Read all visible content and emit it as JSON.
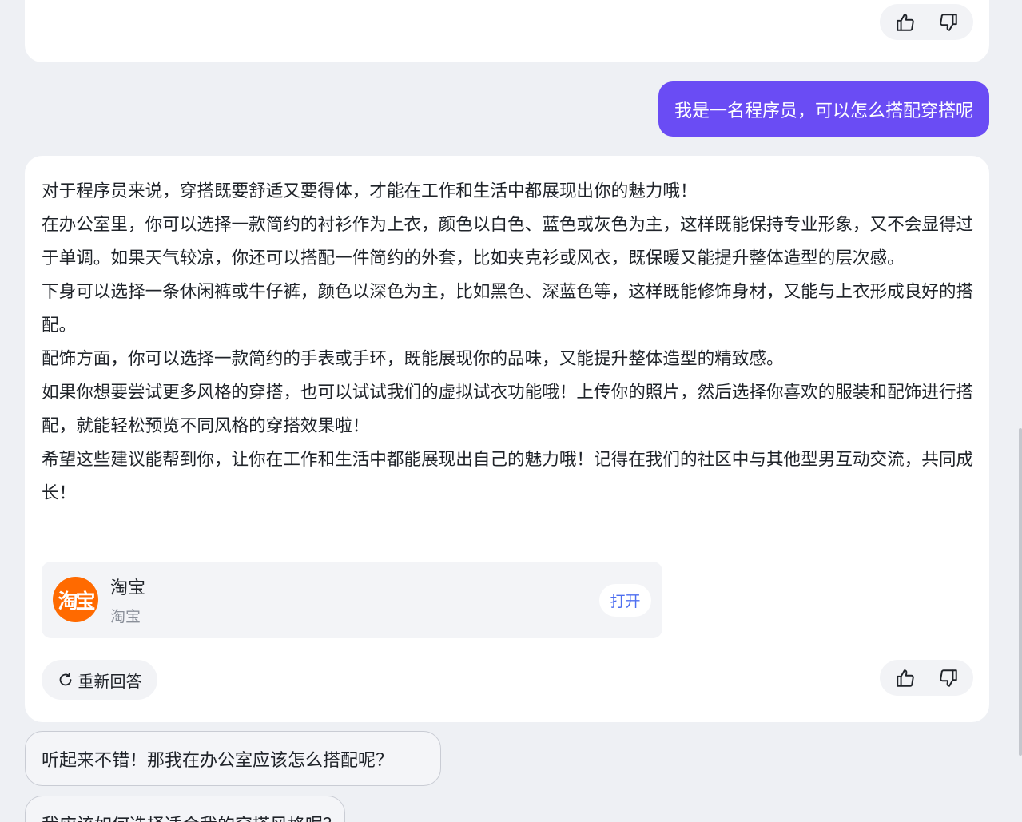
{
  "user_message": "我是一名程序员，可以怎么搭配穿搭呢",
  "answer": {
    "paragraphs": [
      "对于程序员来说，穿搭既要舒适又要得体，才能在工作和生活中都展现出你的魅力哦！",
      "在办公室里，你可以选择一款简约的衬衫作为上衣，颜色以白色、蓝色或灰色为主，这样既能保持专业形象，又不会显得过于单调。如果天气较凉，你还可以搭配一件简约的外套，比如夹克衫或风衣，既保暖又能提升整体造型的层次感。",
      "下身可以选择一条休闲裤或牛仔裤，颜色以深色为主，比如黑色、深蓝色等，这样既能修饰身材，又能与上衣形成良好的搭配。",
      "配饰方面，你可以选择一款简约的手表或手环，既能展现你的品味，又能提升整体造型的精致感。",
      "如果你想要尝试更多风格的穿搭，也可以试试我们的虚拟试衣功能哦！上传你的照片，然后选择你喜欢的服装和配饰进行搭配，就能轻松预览不同风格的穿搭效果啦！",
      "希望这些建议能帮到你，让你在工作和生活中都能展现出自己的魅力哦！记得在我们的社区中与其他型男互动交流，共同成长！"
    ]
  },
  "app_card": {
    "logo_text": "淘宝",
    "name": "淘宝",
    "subtitle": "淘宝",
    "open_label": "打开"
  },
  "regenerate_label": "重新回答",
  "suggestions": [
    "听起来不错！那我在办公室应该怎么搭配呢？",
    "我应该如何选择适合我的穿搭风格呢？"
  ],
  "colors": {
    "user_bubble": "#6a4cf4",
    "taobao_orange": "#ff6a00",
    "open_link": "#4d6ef0"
  },
  "icons": [
    "thumbs-up-icon",
    "thumbs-down-icon",
    "refresh-icon"
  ]
}
